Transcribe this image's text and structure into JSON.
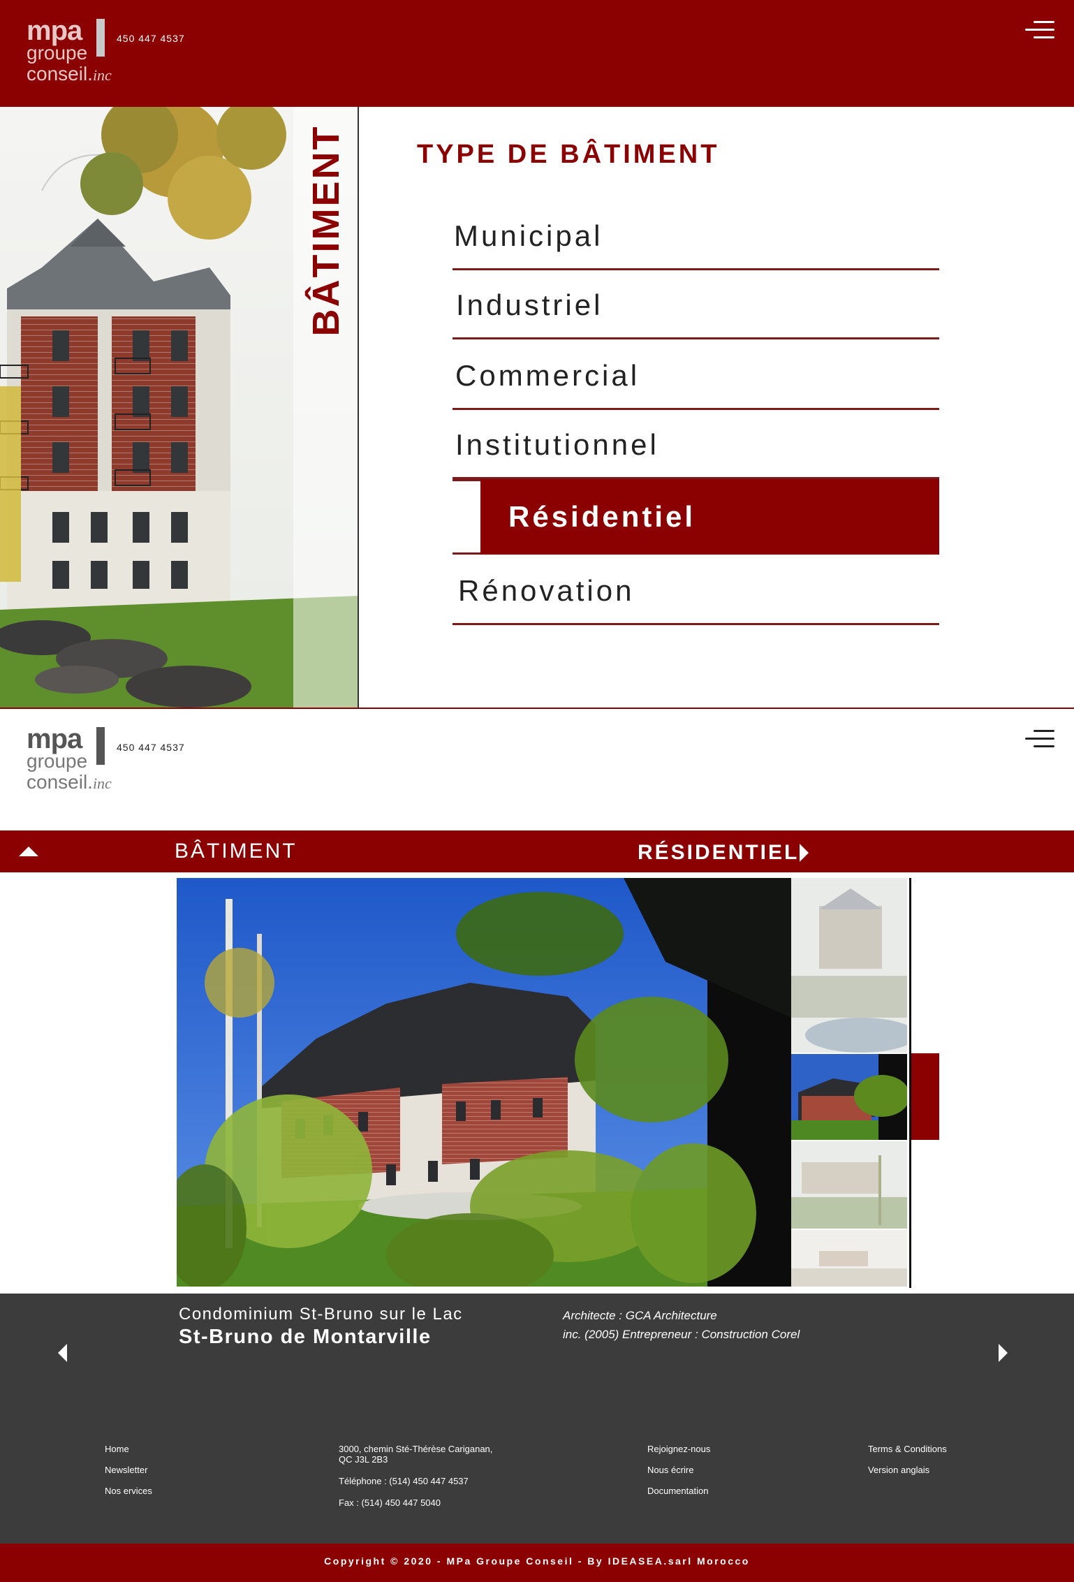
{
  "header": {
    "logo": {
      "line1": "mpa",
      "line2": "groupe",
      "line3": "conseil.",
      "suffix": "inc"
    },
    "phone": "450 447 4537"
  },
  "building_panel": {
    "vertical_label": "BÂTIMENT",
    "title": "TYPE DE BÂTIMENT",
    "types": [
      "Municipal",
      "Industriel",
      "Commercial",
      "Institutionnel",
      "Résidentiel",
      "Rénovation"
    ],
    "active_type": "Résidentiel"
  },
  "breadcrumb": {
    "section": "BÂTIMENT",
    "current": "RÉSIDENTIEL"
  },
  "project": {
    "name": "Condominium St-Bruno sur le Lac",
    "city": "St-Bruno de Montarville",
    "credits_line1": "Architecte : GCA Architecture",
    "credits_line2": "inc. (2005) Entrepreneur : Construction Corel"
  },
  "footer": {
    "col1": [
      "Home",
      "Newsletter",
      "Nos ervices"
    ],
    "address_line1": "3000, chemin Sté-Thérèse Cariganan,",
    "address_line2": "QC J3L 2B3",
    "telephone": "Téléphone : (514) 450 447 4537",
    "fax": "Fax : (514) 450 447 5040",
    "col3": [
      "Rejoignez-nous",
      "Nous écrire",
      "Documentation"
    ],
    "col4": [
      "Terms & Conditions",
      "Version anglais"
    ],
    "copyright": "Copyright © 2020 - MPa Groupe Conseil - By IDEASEA.sarl Morocco"
  },
  "colors": {
    "brand_red": "#8b0000",
    "footer_gray": "#3c3c3c"
  },
  "icons": [
    "menu-icon",
    "arrow-up-icon",
    "arrow-right-icon",
    "arrow-left-icon"
  ]
}
